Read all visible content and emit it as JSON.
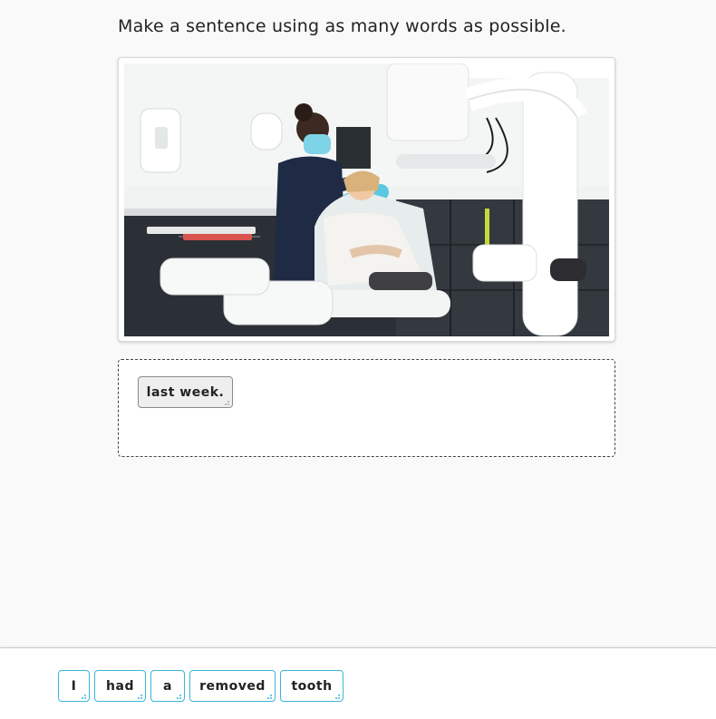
{
  "instruction": "Make a sentence using as many words as possible.",
  "answer": {
    "placed_words": [
      "last week."
    ]
  },
  "word_bank": {
    "words": [
      "I",
      "had",
      "a",
      "removed",
      "tooth"
    ]
  },
  "colors": {
    "accent": "#38b6d8",
    "background": "#f9f9f9"
  }
}
